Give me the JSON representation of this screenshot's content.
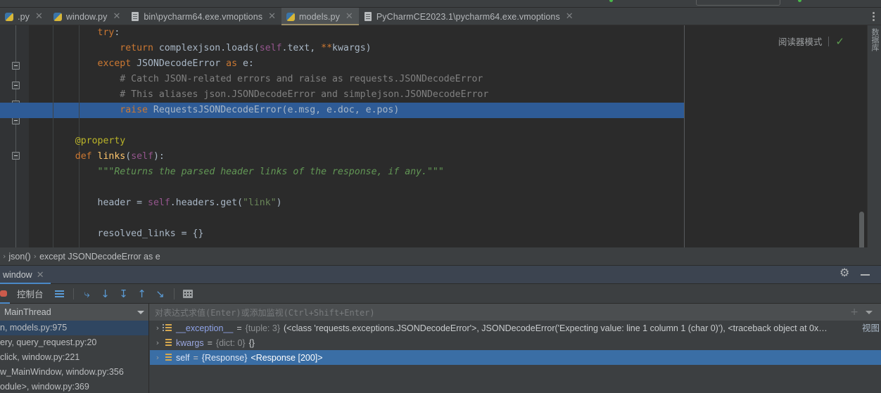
{
  "window": {
    "theme_accent": "#4a88c7",
    "editor_bg": "#2b2b2b",
    "chrome_bg": "#3c3f41",
    "selection_blue": "#2e5b96"
  },
  "editor_tabs": [
    {
      "label": ".py",
      "icon": "python-file-icon",
      "active": false,
      "close": "✕"
    },
    {
      "label": "window.py",
      "icon": "python-file-icon",
      "active": false,
      "close": "✕"
    },
    {
      "label": "bin\\pycharm64.exe.vmoptions",
      "icon": "text-file-icon",
      "active": false,
      "close": "✕"
    },
    {
      "label": "models.py",
      "icon": "python-file-icon",
      "active": true,
      "close": "✕"
    },
    {
      "label": "PyCharmCE2023.1\\pycharm64.exe.vmoptions",
      "icon": "text-file-icon",
      "active": false,
      "close": "✕"
    }
  ],
  "tabbar": {
    "overflow_menu_icon": "kebab-menu-icon"
  },
  "editor": {
    "reader_mode_label": "阅读器模式",
    "inspection_icon": "green-check-icon",
    "right_strip_text": "数据库",
    "highlighted_line_index": 5,
    "lines": [
      {
        "indent": 8,
        "tokens": [
          {
            "t": "try",
            "c": "k"
          },
          {
            "t": ":",
            "c": "f"
          }
        ]
      },
      {
        "indent": 12,
        "tokens": [
          {
            "t": "return ",
            "c": "k"
          },
          {
            "t": "complexjson.loads(",
            "c": "f"
          },
          {
            "t": "self",
            "c": "self"
          },
          {
            "t": ".text, ",
            "c": "f"
          },
          {
            "t": "**",
            "c": "k"
          },
          {
            "t": "kwargs)",
            "c": "f"
          }
        ]
      },
      {
        "indent": 8,
        "tokens": [
          {
            "t": "except ",
            "c": "k"
          },
          {
            "t": "JSONDecodeError ",
            "c": "f"
          },
          {
            "t": "as ",
            "c": "k"
          },
          {
            "t": "e:",
            "c": "f"
          }
        ]
      },
      {
        "indent": 12,
        "tokens": [
          {
            "t": "# Catch JSON-related errors and raise as requests.JSONDecodeError",
            "c": "c"
          }
        ]
      },
      {
        "indent": 12,
        "tokens": [
          {
            "t": "# This aliases json.JSONDecodeError and simplejson.JSONDecodeError",
            "c": "c"
          }
        ]
      },
      {
        "indent": 12,
        "tokens": [
          {
            "t": "raise ",
            "c": "k"
          },
          {
            "t": "RequestsJSONDecodeError(e.msg, e.doc, e.pos)",
            "c": "f"
          }
        ]
      },
      {
        "indent": 0,
        "tokens": []
      },
      {
        "indent": 4,
        "tokens": [
          {
            "t": "@property",
            "c": "dec"
          }
        ]
      },
      {
        "indent": 4,
        "tokens": [
          {
            "t": "def ",
            "c": "k"
          },
          {
            "t": "links",
            "c": "fn"
          },
          {
            "t": "(",
            "c": "f"
          },
          {
            "t": "self",
            "c": "self"
          },
          {
            "t": "):",
            "c": "f"
          }
        ]
      },
      {
        "indent": 8,
        "tokens": [
          {
            "t": "\"\"\"Returns the parsed header links of the response, if any.\"\"\"",
            "c": "d"
          }
        ]
      },
      {
        "indent": 0,
        "tokens": []
      },
      {
        "indent": 8,
        "tokens": [
          {
            "t": "header = ",
            "c": "f"
          },
          {
            "t": "self",
            "c": "self"
          },
          {
            "t": ".headers.get(",
            "c": "f"
          },
          {
            "t": "\"link\"",
            "c": "s"
          },
          {
            "t": ")",
            "c": "f"
          }
        ]
      },
      {
        "indent": 0,
        "tokens": []
      },
      {
        "indent": 8,
        "tokens": [
          {
            "t": "resolved_links = {}",
            "c": "f"
          }
        ]
      }
    ]
  },
  "breadcrumb": {
    "arrow": "›",
    "items": [
      "json()",
      "except JSONDecodeError as e"
    ]
  },
  "debug": {
    "tab_label": "window",
    "tab_close": "✕",
    "settings_icon": "gear-icon",
    "minimize_icon": "minimize-icon",
    "console_label": "控制台",
    "toolbar_icons": [
      {
        "name": "show-execution-point-icon",
        "glyph": "☰"
      },
      {
        "name": "step-over-icon",
        "glyph": "⤷"
      },
      {
        "name": "step-into-icon",
        "glyph": "↓"
      },
      {
        "name": "force-step-into-icon",
        "glyph": "↧"
      },
      {
        "name": "step-out-icon",
        "glyph": "↑"
      },
      {
        "name": "run-to-cursor-icon",
        "glyph": "↘"
      },
      {
        "name": "evaluate-expression-icon",
        "glyph": "▦"
      }
    ],
    "thread_label": "MainThread",
    "watch_placeholder": "对表达式求值(Enter)或添加监视(Ctrl+Shift+Enter)",
    "watch_add_icon": "plus-icon",
    "watch_menu_icon": "chevron-down-icon",
    "frames": [
      {
        "text": "n, models.py:975",
        "selected": true
      },
      {
        "text": "ery, query_request.py:20",
        "selected": false
      },
      {
        "text": "click, window.py:221",
        "selected": false
      },
      {
        "text": "w_MainWindow, window.py:356",
        "selected": false
      },
      {
        "text": "odule>, window.py:369",
        "selected": false
      }
    ],
    "variables": [
      {
        "caret": "›",
        "name": "__exception__",
        "eq": " = ",
        "type": "{tuple: 3}",
        "value": " (<class 'requests.exceptions.JSONDecodeError'>, JSONDecodeError('Expecting value: line 1 column 1 (char 0)'), <traceback object at 0x…",
        "selected": false
      },
      {
        "caret": "›",
        "name": "kwargs",
        "eq": " = ",
        "type": "{dict: 0}",
        "value": " {}",
        "selected": false
      },
      {
        "caret": "›",
        "name": "self",
        "eq": " = ",
        "type": "{Response}",
        "value": " <Response [200]>",
        "selected": true
      }
    ],
    "view_link": "视图"
  }
}
